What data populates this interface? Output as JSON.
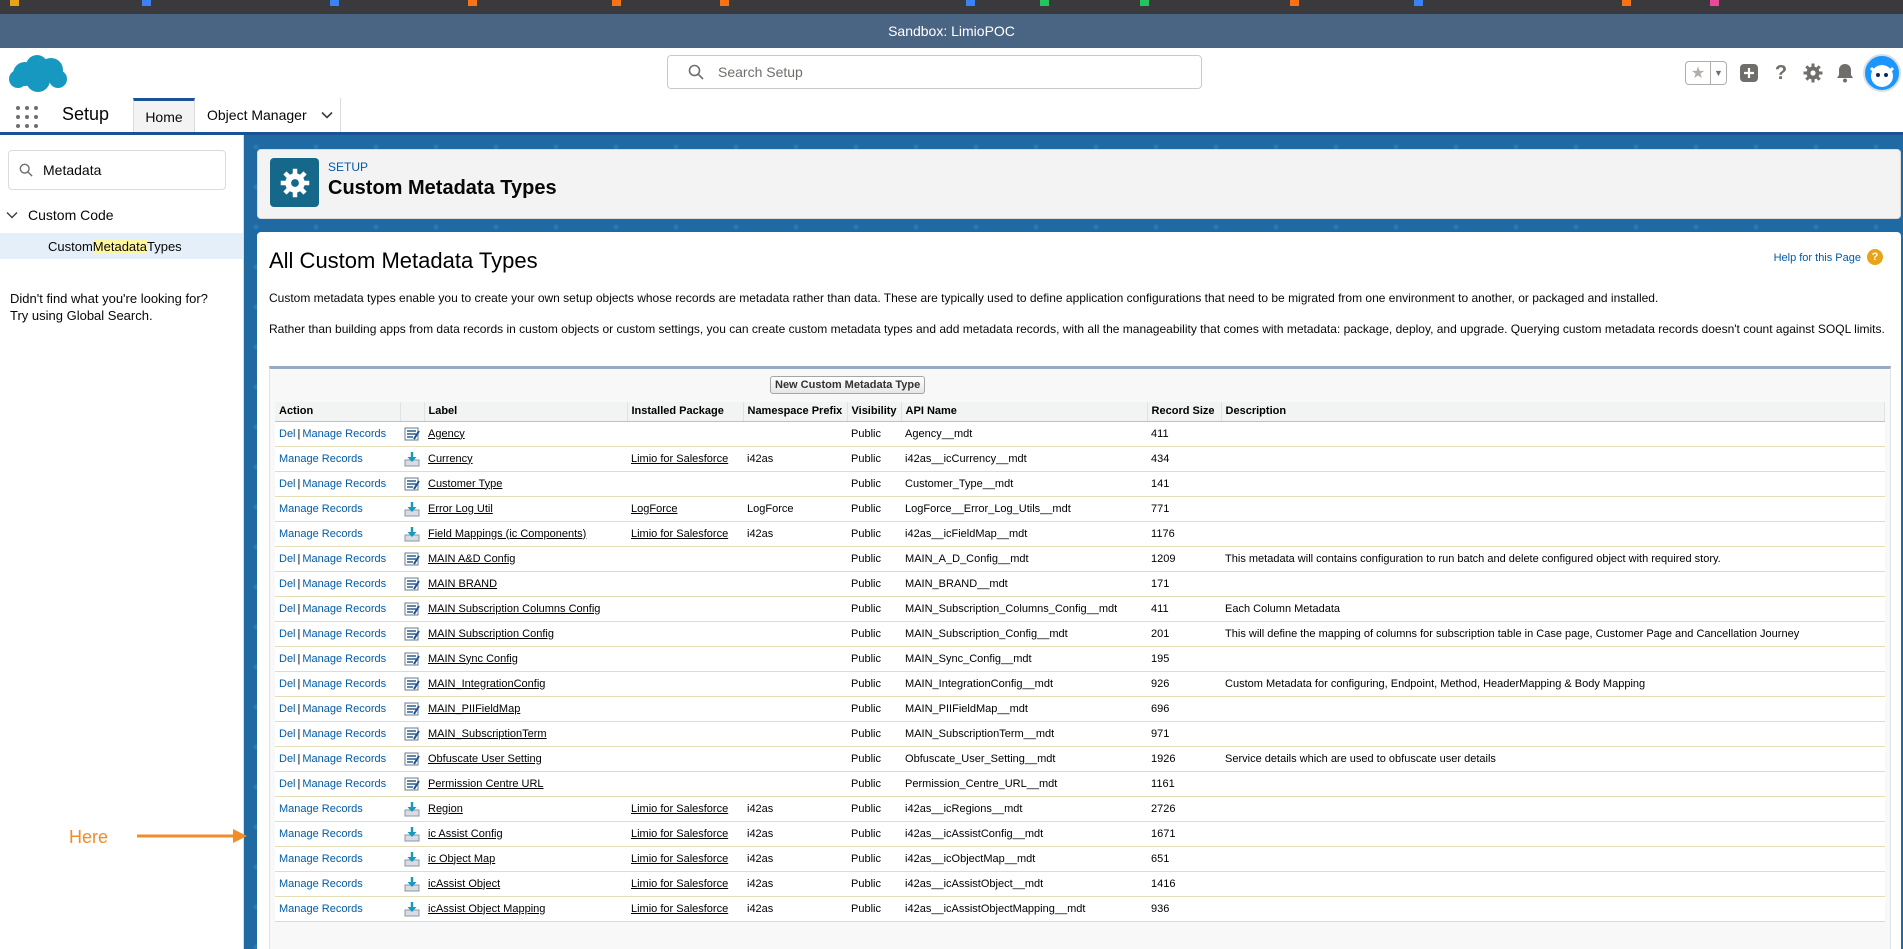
{
  "sandbox_label": "Sandbox: LimioPOC",
  "header": {
    "search_placeholder": "Search Setup"
  },
  "nav": {
    "app_name": "Setup",
    "tabs": [
      {
        "label": "Home"
      },
      {
        "label": "Object Manager"
      }
    ]
  },
  "sidebar": {
    "quickfind_value": "Metadata",
    "tree_node": "Custom Code",
    "leaf_before": "Custom ",
    "leaf_highlight": "Metadata",
    "leaf_after": " Types",
    "notfound_line1": "Didn't find what you're looking for?",
    "notfound_line2": "Try using Global Search."
  },
  "page_header": {
    "eyebrow": "SETUP",
    "title": "Custom Metadata Types"
  },
  "content": {
    "title": "All Custom Metadata Types",
    "help_link": "Help for this Page",
    "help_icon": "?",
    "intro1": "Custom metadata types enable you to create your own setup objects whose records are metadata rather than data. These are typically used to define application configurations that need to be migrated from one environment to another, or packaged and installed.",
    "intro2": "Rather than building apps from data records in custom objects or custom settings, you can create custom metadata types and add metadata records, with all the manageability that comes with metadata: package, deploy, and upgrade. Querying custom metadata records doesn't count against SOQL limits.",
    "new_button": "New Custom Metadata Type"
  },
  "table": {
    "columns": [
      "Action",
      "",
      "Label",
      "Installed Package",
      "Namespace Prefix",
      "Visibility",
      "API Name",
      "Record Size",
      "Description"
    ],
    "del_label": "Del",
    "sep": "|",
    "manage_label": "Manage Records",
    "rows": [
      {
        "del": true,
        "icon": "custom-type-icon",
        "label": "Agency",
        "package": "",
        "prefix": "",
        "visibility": "Public",
        "api": "Agency__mdt",
        "size": "411",
        "desc": ""
      },
      {
        "del": false,
        "icon": "installed-package-icon",
        "label": "Currency",
        "package": "Limio for Salesforce",
        "prefix": "i42as",
        "visibility": "Public",
        "api": "i42as__icCurrency__mdt",
        "size": "434",
        "desc": ""
      },
      {
        "del": true,
        "icon": "custom-type-icon",
        "label": "Customer Type",
        "package": "",
        "prefix": "",
        "visibility": "Public",
        "api": "Customer_Type__mdt",
        "size": "141",
        "desc": ""
      },
      {
        "del": false,
        "icon": "installed-package-icon",
        "label": "Error Log Util",
        "package": "LogForce",
        "prefix": "LogForce",
        "visibility": "Public",
        "api": "LogForce__Error_Log_Utils__mdt",
        "size": "771",
        "desc": ""
      },
      {
        "del": false,
        "icon": "installed-package-icon",
        "label": "Field Mappings (ic Components)",
        "package": "Limio for Salesforce",
        "prefix": "i42as",
        "visibility": "Public",
        "api": "i42as__icFieldMap__mdt",
        "size": "1176",
        "desc": ""
      },
      {
        "del": true,
        "icon": "custom-type-icon",
        "label": "MAIN A&D Config",
        "package": "",
        "prefix": "",
        "visibility": "Public",
        "api": "MAIN_A_D_Config__mdt",
        "size": "1209",
        "desc": "This metadata will contains configuration to run batch and delete configured object with required story."
      },
      {
        "del": true,
        "icon": "custom-type-icon",
        "label": "MAIN BRAND",
        "package": "",
        "prefix": "",
        "visibility": "Public",
        "api": "MAIN_BRAND__mdt",
        "size": "171",
        "desc": ""
      },
      {
        "del": true,
        "icon": "custom-type-icon",
        "label": "MAIN Subscription Columns Config",
        "package": "",
        "prefix": "",
        "visibility": "Public",
        "api": "MAIN_Subscription_Columns_Config__mdt",
        "size": "411",
        "desc": "Each Column Metadata"
      },
      {
        "del": true,
        "icon": "custom-type-icon",
        "label": "MAIN Subscription Config",
        "package": "",
        "prefix": "",
        "visibility": "Public",
        "api": "MAIN_Subscription_Config__mdt",
        "size": "201",
        "desc": "This will define the mapping of columns for subscription table in Case page, Customer Page and Cancellation Journey"
      },
      {
        "del": true,
        "icon": "custom-type-icon",
        "label": "MAIN Sync Config",
        "package": "",
        "prefix": "",
        "visibility": "Public",
        "api": "MAIN_Sync_Config__mdt",
        "size": "195",
        "desc": ""
      },
      {
        "del": true,
        "icon": "custom-type-icon",
        "label": "MAIN_IntegrationConfig",
        "package": "",
        "prefix": "",
        "visibility": "Public",
        "api": "MAIN_IntegrationConfig__mdt",
        "size": "926",
        "desc": "Custom Metadata for configuring, Endpoint, Method, HeaderMapping & Body Mapping"
      },
      {
        "del": true,
        "icon": "custom-type-icon",
        "label": "MAIN_PIIFieldMap",
        "package": "",
        "prefix": "",
        "visibility": "Public",
        "api": "MAIN_PIIFieldMap__mdt",
        "size": "696",
        "desc": ""
      },
      {
        "del": true,
        "icon": "custom-type-icon",
        "label": "MAIN_SubscriptionTerm",
        "package": "",
        "prefix": "",
        "visibility": "Public",
        "api": "MAIN_SubscriptionTerm__mdt",
        "size": "971",
        "desc": ""
      },
      {
        "del": true,
        "icon": "custom-type-icon",
        "label": "Obfuscate User Setting",
        "package": "",
        "prefix": "",
        "visibility": "Public",
        "api": "Obfuscate_User_Setting__mdt",
        "size": "1926",
        "desc": "Service details which are used to obfuscate user details"
      },
      {
        "del": true,
        "icon": "custom-type-icon",
        "label": "Permission Centre URL",
        "package": "",
        "prefix": "",
        "visibility": "Public",
        "api": "Permission_Centre_URL__mdt",
        "size": "1161",
        "desc": ""
      },
      {
        "del": false,
        "icon": "installed-package-icon",
        "label": "Region",
        "package": "Limio for Salesforce",
        "prefix": "i42as",
        "visibility": "Public",
        "api": "i42as__icRegions__mdt",
        "size": "2726",
        "desc": ""
      },
      {
        "del": false,
        "icon": "installed-package-icon",
        "label": "ic Assist Config",
        "package": "Limio for Salesforce",
        "prefix": "i42as",
        "visibility": "Public",
        "api": "i42as__icAssistConfig__mdt",
        "size": "1671",
        "desc": ""
      },
      {
        "del": false,
        "icon": "installed-package-icon",
        "label": "ic Object Map",
        "package": "Limio for Salesforce",
        "prefix": "i42as",
        "visibility": "Public",
        "api": "i42as__icObjectMap__mdt",
        "size": "651",
        "desc": ""
      },
      {
        "del": false,
        "icon": "installed-package-icon",
        "label": "icAssist Object",
        "package": "Limio for Salesforce",
        "prefix": "i42as",
        "visibility": "Public",
        "api": "i42as__icAssistObject__mdt",
        "size": "1416",
        "desc": ""
      },
      {
        "del": false,
        "icon": "installed-package-icon",
        "label": "icAssist Object Mapping",
        "package": "Limio for Salesforce",
        "prefix": "i42as",
        "visibility": "Public",
        "api": "i42as__icAssistObjectMapping__mdt",
        "size": "936",
        "desc": ""
      }
    ]
  },
  "annotation": {
    "label": "Here",
    "color": "#f28c28"
  },
  "colors": {
    "link": "#015ba7",
    "brand_blue": "#1b5297",
    "sandbox_bar": "#4a6584",
    "setup_icon": "#16688a"
  }
}
